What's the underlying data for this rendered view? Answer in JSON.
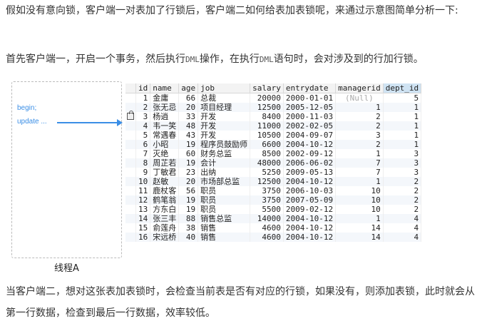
{
  "intro": {
    "text": "假如没有意向锁，客户端一对表加了行锁后，客户端二如何给表加表锁呢，来通过示意图简单分析一下:"
  },
  "step": {
    "before": "首先客户端一，开启一个事务，然后执行",
    "code1": "DML",
    "middle": "操作，在执行",
    "code2": "DML",
    "after": "语句时，会对涉及到的行加行锁。"
  },
  "thread": {
    "line1": "begin;",
    "line2": "update ...",
    "caption": "线程A",
    "arrow_color": "#3a8ee6"
  },
  "table": {
    "columns": [
      "id",
      "name",
      "age",
      "job",
      "salary",
      "entrydate",
      "managerid",
      "dept_id"
    ],
    "highlighted_column": "dept_id",
    "locked_row_id": "3",
    "lock_icon": "lock-icon",
    "rows": [
      [
        "1",
        "金庸",
        "66",
        "总裁",
        "20000",
        "2000-01-01",
        "(Null)",
        "5"
      ],
      [
        "2",
        "张无忌",
        "20",
        "项目经理",
        "12500",
        "2005-12-05",
        "1",
        "1"
      ],
      [
        "3",
        "杨逍",
        "33",
        "开发",
        "8400",
        "2000-11-03",
        "2",
        "1"
      ],
      [
        "4",
        "韦一笑",
        "48",
        "开发",
        "11000",
        "2002-02-05",
        "2",
        "1"
      ],
      [
        "5",
        "常遇春",
        "43",
        "开发",
        "10500",
        "2004-09-07",
        "3",
        "1"
      ],
      [
        "6",
        "小昭",
        "19",
        "程序员鼓励师",
        "6600",
        "2004-10-12",
        "2",
        "1"
      ],
      [
        "7",
        "灭绝",
        "60",
        "财务总监",
        "8500",
        "2002-09-12",
        "1",
        "3"
      ],
      [
        "8",
        "周芷若",
        "19",
        "会计",
        "48000",
        "2006-06-02",
        "7",
        "3"
      ],
      [
        "9",
        "丁敏君",
        "23",
        "出纳",
        "5250",
        "2009-05-13",
        "7",
        "3"
      ],
      [
        "10",
        "赵敏",
        "20",
        "市场部总监",
        "12500",
        "2004-10-12",
        "1",
        "2"
      ],
      [
        "11",
        "鹿杖客",
        "56",
        "职员",
        "3750",
        "2006-10-03",
        "10",
        "2"
      ],
      [
        "12",
        "鹤笔翁",
        "19",
        "职员",
        "3750",
        "2007-05-09",
        "10",
        "2"
      ],
      [
        "13",
        "方东白",
        "19",
        "职员",
        "5500",
        "2009-02-12",
        "10",
        "2"
      ],
      [
        "14",
        "张三丰",
        "88",
        "销售总监",
        "14000",
        "2004-10-12",
        "1",
        "4"
      ],
      [
        "15",
        "俞莲舟",
        "38",
        "销售",
        "4600",
        "2004-10-12",
        "14",
        "4"
      ],
      [
        "16",
        "宋远桥",
        "40",
        "销售",
        "4600",
        "2004-10-12",
        "14",
        "4"
      ]
    ]
  },
  "outro": {
    "text": "当客户端二，想对这张表加表锁时，会检查当前表是否有对应的行锁，如果没有，则添加表锁，此时就会从第一行数据，检查到最后一行数据，效率较低。"
  }
}
